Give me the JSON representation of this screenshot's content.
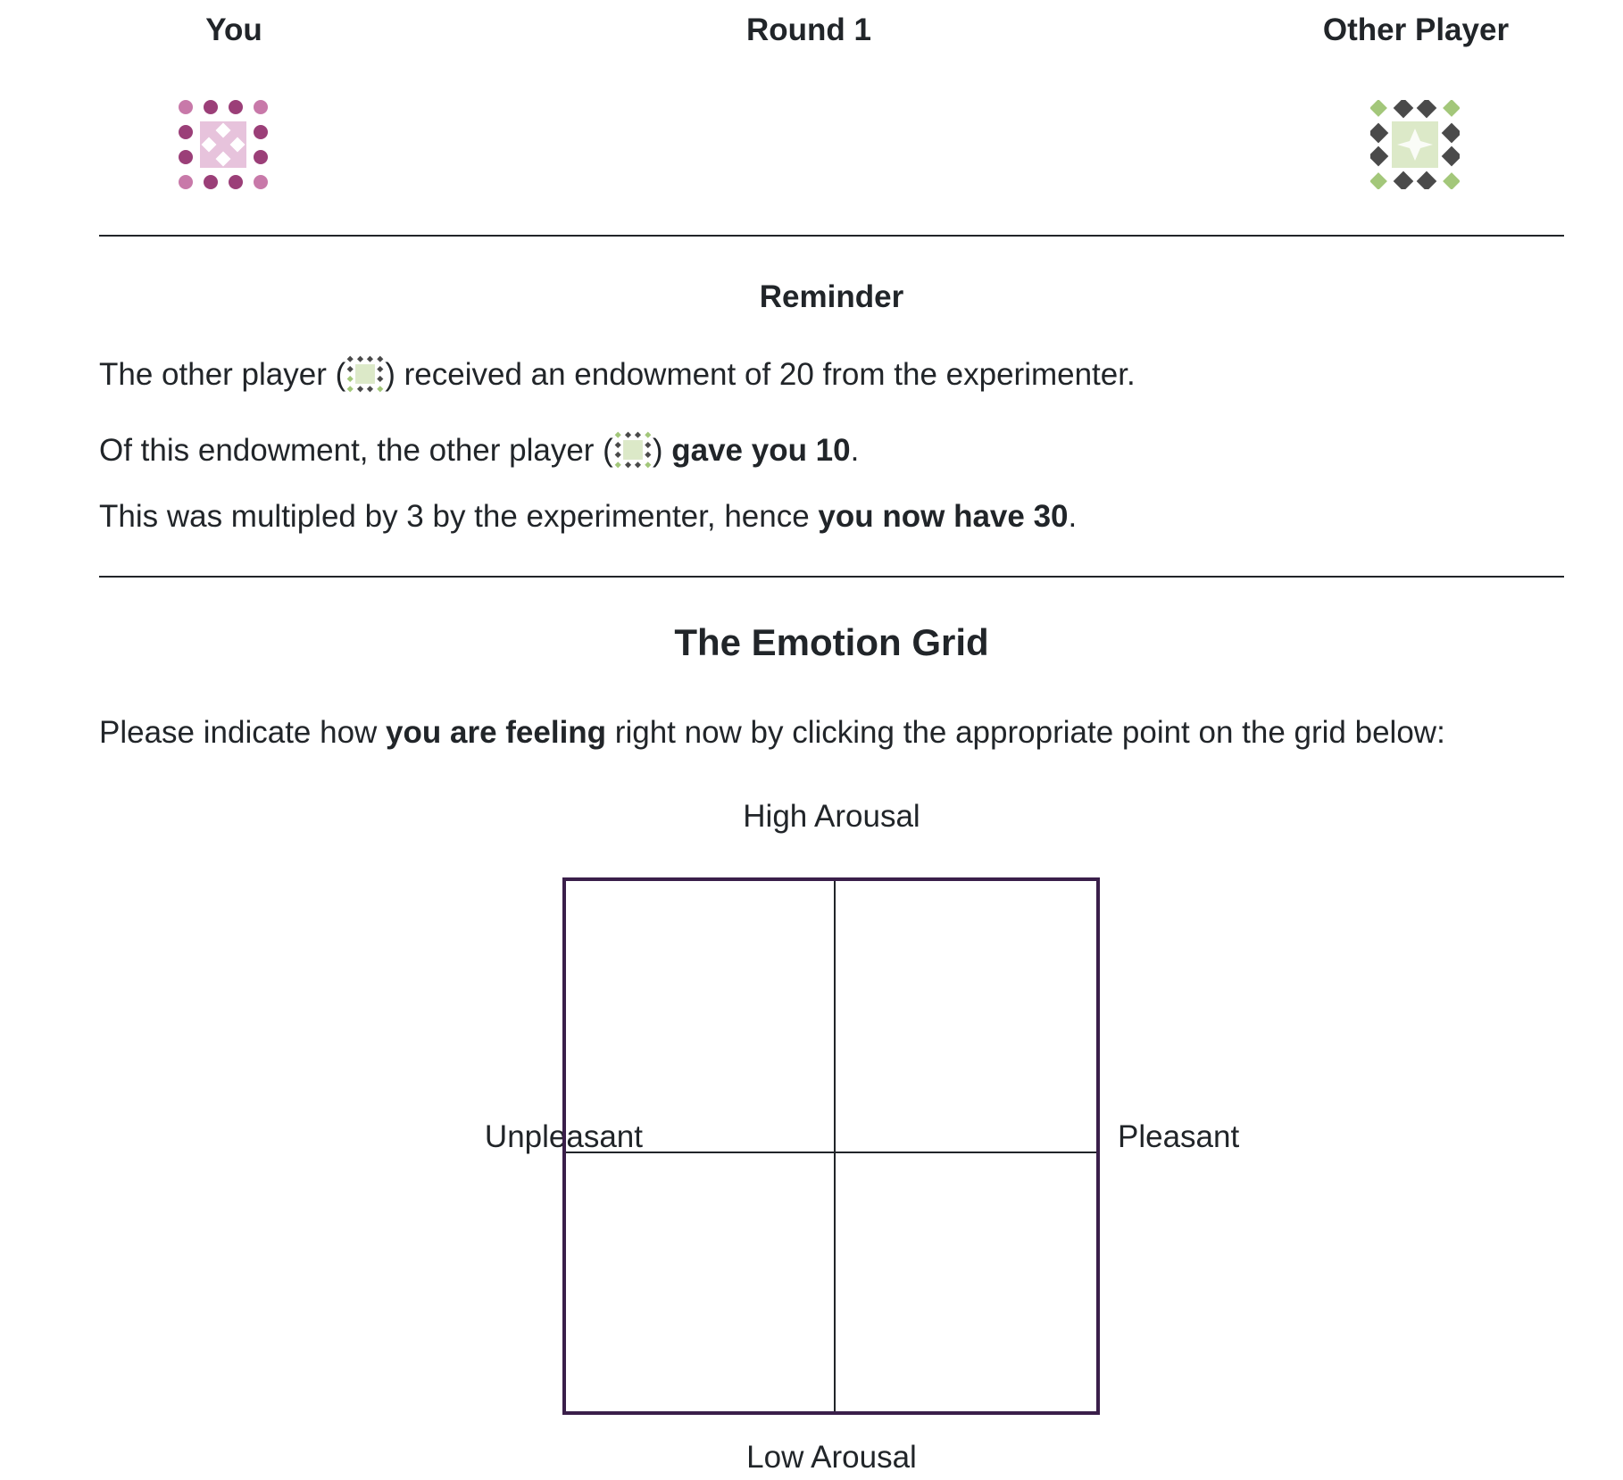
{
  "header": {
    "you_label": "You",
    "round_label": "Round 1",
    "other_label": "Other Player"
  },
  "colors": {
    "you_primary": "#9b3f78",
    "you_secondary": "#c879a9",
    "you_tile": "#e7c3dc",
    "other_primary": "#4a4a4a",
    "other_secondary": "#a3c77a",
    "other_tile": "#dce9c8",
    "grid_border": "#3a1f4a"
  },
  "reminder": {
    "title": "Reminder",
    "line1": {
      "before": "The other player (",
      "after": ") received an endowment of 20 from the experimenter."
    },
    "line2": {
      "before": "Of this endowment, the other player (",
      "middle": ") ",
      "bold": "gave you 10",
      "after": "."
    },
    "line3": {
      "before": "This was multipled by 3 by the experimenter, hence ",
      "bold": "you now have 30",
      "after": "."
    }
  },
  "emotion_grid": {
    "title": "The Emotion Grid",
    "instruction": {
      "before": "Please indicate how ",
      "bold": "you are feeling",
      "after": " right now by clicking the appropriate point on the grid below:"
    },
    "top_label": "High Arousal",
    "bottom_label": "Low Arousal",
    "left_label": "Unpleasant",
    "right_label": "Pleasant"
  }
}
